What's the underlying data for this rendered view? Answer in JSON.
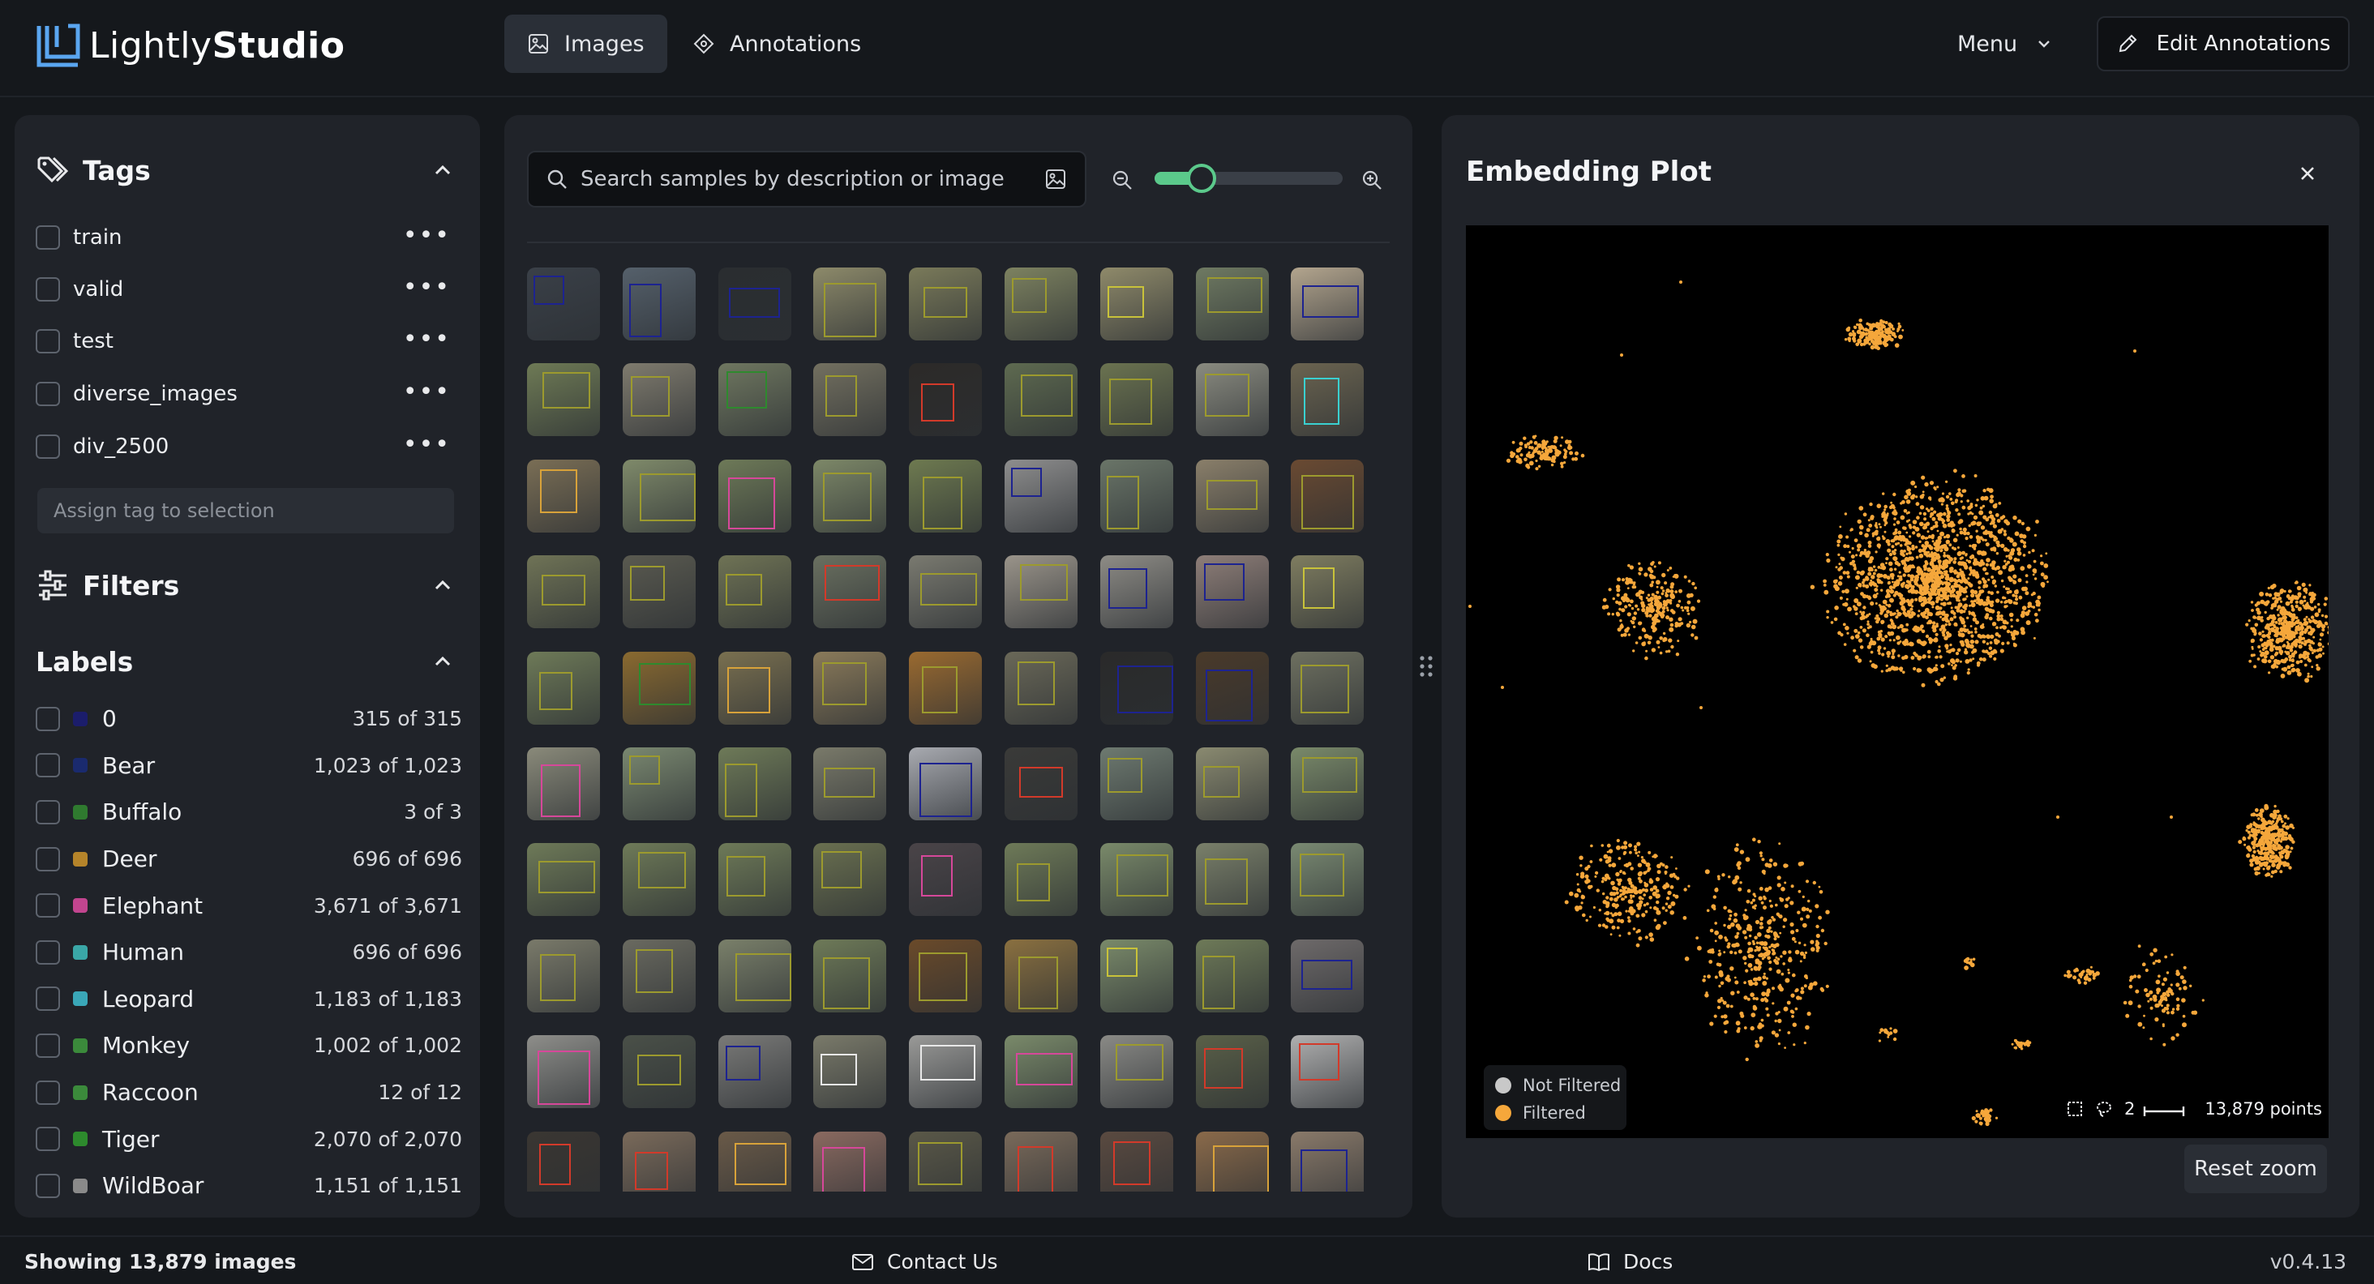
{
  "app": {
    "logo_light": "Lightly",
    "logo_bold": "Studio"
  },
  "nav": {
    "tabs": [
      {
        "label": "Images",
        "icon": "image-icon",
        "active": true
      },
      {
        "label": "Annotations",
        "icon": "annotations-icon",
        "active": false
      }
    ],
    "menu_label": "Menu",
    "edit_label": "Edit Annotations"
  },
  "tags": {
    "title": "Tags",
    "items": [
      {
        "label": "train"
      },
      {
        "label": "valid"
      },
      {
        "label": "test"
      },
      {
        "label": "diverse_images"
      },
      {
        "label": "div_2500"
      }
    ],
    "assign_placeholder": "Assign tag to selection",
    "more_glyph": "•••"
  },
  "filters": {
    "title": "Filters"
  },
  "labels": {
    "title": "Labels",
    "items": [
      {
        "name": "0",
        "count": "315 of 315",
        "color": "#1b1d6b"
      },
      {
        "name": "Bear",
        "count": "1,023 of 1,023",
        "color": "#1a2a6e"
      },
      {
        "name": "Buffalo",
        "count": "3 of 3",
        "color": "#2f7a2f"
      },
      {
        "name": "Deer",
        "count": "696 of 696",
        "color": "#b5842a"
      },
      {
        "name": "Elephant",
        "count": "3,671 of 3,671",
        "color": "#c2458f"
      },
      {
        "name": "Human",
        "count": "696 of 696",
        "color": "#3aa7a7"
      },
      {
        "name": "Leopard",
        "count": "1,183 of 1,183",
        "color": "#3aa7b8"
      },
      {
        "name": "Monkey",
        "count": "1,002 of 1,002",
        "color": "#3b8a3b"
      },
      {
        "name": "Raccoon",
        "count": "12 of 12",
        "color": "#3b8a3b"
      },
      {
        "name": "Tiger",
        "count": "2,070 of 2,070",
        "color": "#2d8a2d"
      },
      {
        "name": "WildBoar",
        "count": "1,151 of 1,151",
        "color": "#8a8a8a"
      }
    ]
  },
  "search": {
    "placeholder": "Search samples by description or image",
    "zoom_level": 0.25
  },
  "plot": {
    "title": "Embedding Plot",
    "legend": [
      {
        "label": "Not Filtered",
        "color": "#c8c8c8"
      },
      {
        "label": "Filtered",
        "color": "#f5a73b"
      }
    ],
    "scale_value": "2",
    "points_label": "13,879 points",
    "point_color": "#f5a73b",
    "reset_label": "Reset zoom"
  },
  "footer": {
    "status": "Showing 13,879 images",
    "contact": "Contact Us",
    "docs": "Docs",
    "version": "v0.4.13"
  },
  "thumbnails": [
    {
      "bg": "#3a4048",
      "box": "#1d2390"
    },
    {
      "bg": "#55606b",
      "box": "#1d2390"
    },
    {
      "bg": "#2a2d30",
      "box": "#1d2390"
    },
    {
      "bg": "#8d8a6a",
      "box": "#9c9a2e"
    },
    {
      "bg": "#7a7a5a",
      "box": "#9c9a2e"
    },
    {
      "bg": "#7d8260",
      "box": "#9c9a2e"
    },
    {
      "bg": "#8f8a6a",
      "box": "#c8c23a"
    },
    {
      "bg": "#6f7a62",
      "box": "#9c9a2e"
    },
    {
      "bg": "#b3a58e",
      "box": "#1d2390"
    },
    {
      "bg": "#6e7a55",
      "box": "#9c9a2e"
    },
    {
      "bg": "#7f7b6e",
      "box": "#9c9a2e"
    },
    {
      "bg": "#6f7760",
      "box": "#2e8a2e"
    },
    {
      "bg": "#737060",
      "box": "#9c9a2e"
    },
    {
      "bg": "#2c2a28",
      "box": "#d23a2a"
    },
    {
      "bg": "#5e6a50",
      "box": "#9c9a2e"
    },
    {
      "bg": "#6b7350",
      "box": "#9c9a2e"
    },
    {
      "bg": "#8a8b80",
      "box": "#9c9a2e"
    },
    {
      "bg": "#6b6450",
      "box": "#3ad0d0"
    },
    {
      "bg": "#7a6e55",
      "box": "#d8a23a"
    },
    {
      "bg": "#7f8a6a",
      "box": "#9c9a2e"
    },
    {
      "bg": "#6e7a58",
      "box": "#d6489a"
    },
    {
      "bg": "#7d8868",
      "box": "#9c9a2e"
    },
    {
      "bg": "#6e7a50",
      "box": "#9c9a2e"
    },
    {
      "bg": "#8e8e8e",
      "box": "#1d2390"
    },
    {
      "bg": "#6a7568",
      "box": "#9c9a2e"
    },
    {
      "bg": "#8a7f6a",
      "box": "#9c9a2e"
    },
    {
      "bg": "#6a4a32",
      "box": "#9c9a2e"
    },
    {
      "bg": "#6f7356",
      "box": "#9c9a2e"
    },
    {
      "bg": "#5a5a50",
      "box": "#9c9a2e"
    },
    {
      "bg": "#6f7355",
      "box": "#9c9a2e"
    },
    {
      "bg": "#6a7060",
      "box": "#d23a2a"
    },
    {
      "bg": "#7a7a70",
      "box": "#9c9a2e"
    },
    {
      "bg": "#9a948a",
      "box": "#9c9a2e"
    },
    {
      "bg": "#8e8c86",
      "box": "#1d2390"
    },
    {
      "bg": "#8e7e78",
      "box": "#1d2390"
    },
    {
      "bg": "#7f7d60",
      "box": "#c8c23a"
    },
    {
      "bg": "#6e7a58",
      "box": "#9c9a2e"
    },
    {
      "bg": "#8a6a30",
      "box": "#2e8a2e"
    },
    {
      "bg": "#7a7050",
      "box": "#d8a23a"
    },
    {
      "bg": "#8a7a5a",
      "box": "#9c9a2e"
    },
    {
      "bg": "#9a6a30",
      "box": "#9c9a2e"
    },
    {
      "bg": "#6a6858",
      "box": "#9c9a2e"
    },
    {
      "bg": "#2a2a2a",
      "box": "#1d2390"
    },
    {
      "bg": "#4a3a2a",
      "box": "#1d2390"
    },
    {
      "bg": "#6e7060",
      "box": "#9c9a2e"
    },
    {
      "bg": "#8a8a7a",
      "box": "#d6489a"
    },
    {
      "bg": "#7a8870",
      "box": "#9c9a2e"
    },
    {
      "bg": "#6e7a58",
      "box": "#9c9a2e"
    },
    {
      "bg": "#7a7a6a",
      "box": "#9c9a2e"
    },
    {
      "bg": "#a8aab0",
      "box": "#1d2390"
    },
    {
      "bg": "#3a3a38",
      "box": "#d23a2a"
    },
    {
      "bg": "#6e7a70",
      "box": "#9c9a2e"
    },
    {
      "bg": "#8a8a70",
      "box": "#9c9a2e"
    },
    {
      "bg": "#7a8a6a",
      "box": "#9c9a2e"
    },
    {
      "bg": "#6e7a58",
      "box": "#9c9a2e"
    },
    {
      "bg": "#6e7a58",
      "box": "#9c9a2e"
    },
    {
      "bg": "#6e7a58",
      "box": "#9c9a2e"
    },
    {
      "bg": "#6a7050",
      "box": "#9c9a2e"
    },
    {
      "bg": "#4a4448",
      "box": "#d6489a"
    },
    {
      "bg": "#6e7a58",
      "box": "#9c9a2e"
    },
    {
      "bg": "#7a8a6a",
      "box": "#9c9a2e"
    },
    {
      "bg": "#7a806a",
      "box": "#9c9a2e"
    },
    {
      "bg": "#7a8a72",
      "box": "#9c9a2e"
    },
    {
      "bg": "#7a7a6a",
      "box": "#9c9a2e"
    },
    {
      "bg": "#6a6a60",
      "box": "#9c9a2e"
    },
    {
      "bg": "#7a806a",
      "box": "#9c9a2e"
    },
    {
      "bg": "#6e7a58",
      "box": "#9c9a2e"
    },
    {
      "bg": "#6a4a2a",
      "box": "#9c9a2e"
    },
    {
      "bg": "#8a7040",
      "box": "#9c9a2e"
    },
    {
      "bg": "#7a8a6a",
      "box": "#c8c23a"
    },
    {
      "bg": "#6e7a58",
      "box": "#9c9a2e"
    },
    {
      "bg": "#6e6a6a",
      "box": "#1d2390"
    },
    {
      "bg": "#8e8e8a",
      "box": "#d6489a"
    },
    {
      "bg": "#4a5048",
      "box": "#9c9a2e"
    },
    {
      "bg": "#7a7a78",
      "box": "#1d2390"
    },
    {
      "bg": "#7a7a6a",
      "box": "#e8e8e8"
    },
    {
      "bg": "#9a9a98",
      "box": "#e8e8e8"
    },
    {
      "bg": "#7a8a6a",
      "box": "#d6489a"
    },
    {
      "bg": "#8a8a86",
      "box": "#9c9a2e"
    },
    {
      "bg": "#5a6048",
      "box": "#d23a2a"
    },
    {
      "bg": "#b0b0b0",
      "box": "#d23a2a"
    },
    {
      "bg": "#3a3632",
      "box": "#d23a2a"
    },
    {
      "bg": "#7a6a5a",
      "box": "#d23a2a"
    },
    {
      "bg": "#6a5a48",
      "box": "#d8a23a"
    },
    {
      "bg": "#8a6a60",
      "box": "#d6489a"
    },
    {
      "bg": "#5a5848",
      "box": "#9c9a2e"
    },
    {
      "bg": "#7a6a5a",
      "box": "#d23a2a"
    },
    {
      "bg": "#5a4a40",
      "box": "#d23a2a"
    },
    {
      "bg": "#8a6a4a",
      "box": "#d8a23a"
    },
    {
      "bg": "#8a7a6a",
      "box": "#1d2390"
    }
  ]
}
